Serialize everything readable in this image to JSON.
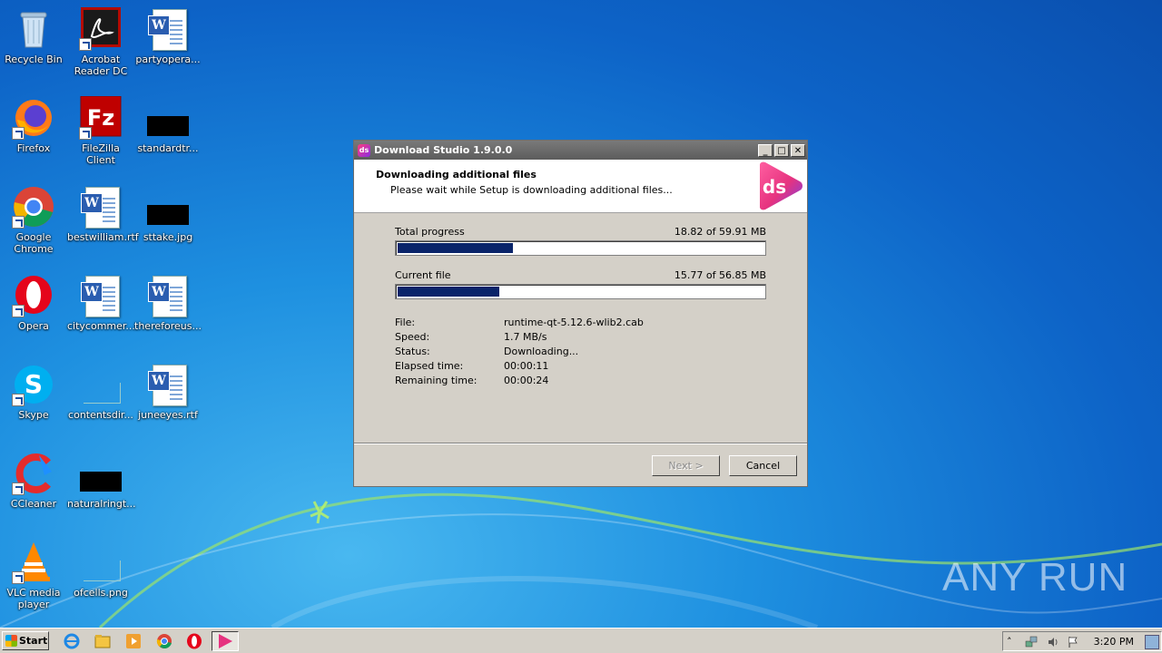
{
  "desktop": {
    "icons": [
      {
        "label": "Recycle Bin",
        "icon": "recycle-bin-icon"
      },
      {
        "label": "Acrobat Reader DC",
        "icon": "acrobat-icon"
      },
      {
        "label": "partyopera...",
        "icon": "word-document-icon"
      },
      {
        "label": "Firefox",
        "icon": "firefox-icon"
      },
      {
        "label": "FileZilla Client",
        "icon": "filezilla-icon"
      },
      {
        "label": "standardtr...",
        "icon": "image-file-icon"
      },
      {
        "label": "Google Chrome",
        "icon": "chrome-icon"
      },
      {
        "label": "bestwilliam.rtf",
        "icon": "word-document-icon"
      },
      {
        "label": "sttake.jpg",
        "icon": "image-file-icon"
      },
      {
        "label": "Opera",
        "icon": "opera-icon"
      },
      {
        "label": "citycommer...",
        "icon": "word-document-icon"
      },
      {
        "label": "thereforeus...",
        "icon": "word-document-icon"
      },
      {
        "label": "Skype",
        "icon": "skype-icon"
      },
      {
        "label": "contentsdir...",
        "icon": "blank-file-icon"
      },
      {
        "label": "juneeyes.rtf",
        "icon": "word-document-icon"
      },
      {
        "label": "CCleaner",
        "icon": "ccleaner-icon"
      },
      {
        "label": "naturalringt...",
        "icon": "image-file-icon"
      },
      {
        "label": "VLC media player",
        "icon": "vlc-icon"
      },
      {
        "label": "ofcells.png",
        "icon": "blank-file-icon"
      }
    ]
  },
  "window": {
    "title": "Download Studio 1.9.0.0",
    "header_title": "Downloading additional files",
    "header_subtitle": "Please wait while Setup is downloading additional files...",
    "logo_text": "ds",
    "total_label": "Total progress",
    "total_value": "18.82 of 59.91 MB",
    "total_fraction": 0.314,
    "current_label": "Current file",
    "current_value": "15.77 of 56.85 MB",
    "current_fraction": 0.277,
    "details": [
      {
        "label": "File:",
        "value": "runtime-qt-5.12.6-wlib2.cab"
      },
      {
        "label": "Speed:",
        "value": "1.7 MB/s"
      },
      {
        "label": "Status:",
        "value": "Downloading..."
      },
      {
        "label": "Elapsed time:",
        "value": "00:00:11"
      },
      {
        "label": "Remaining time:",
        "value": "00:00:24"
      }
    ],
    "next_label": "Next >",
    "cancel_label": "Cancel"
  },
  "taskbar": {
    "start_label": "Start",
    "clock": "3:20 PM"
  },
  "watermark": "ANY RUN",
  "colors": {
    "progress_fill": "#0a246a",
    "desktop_blue": "#1e90e0"
  }
}
